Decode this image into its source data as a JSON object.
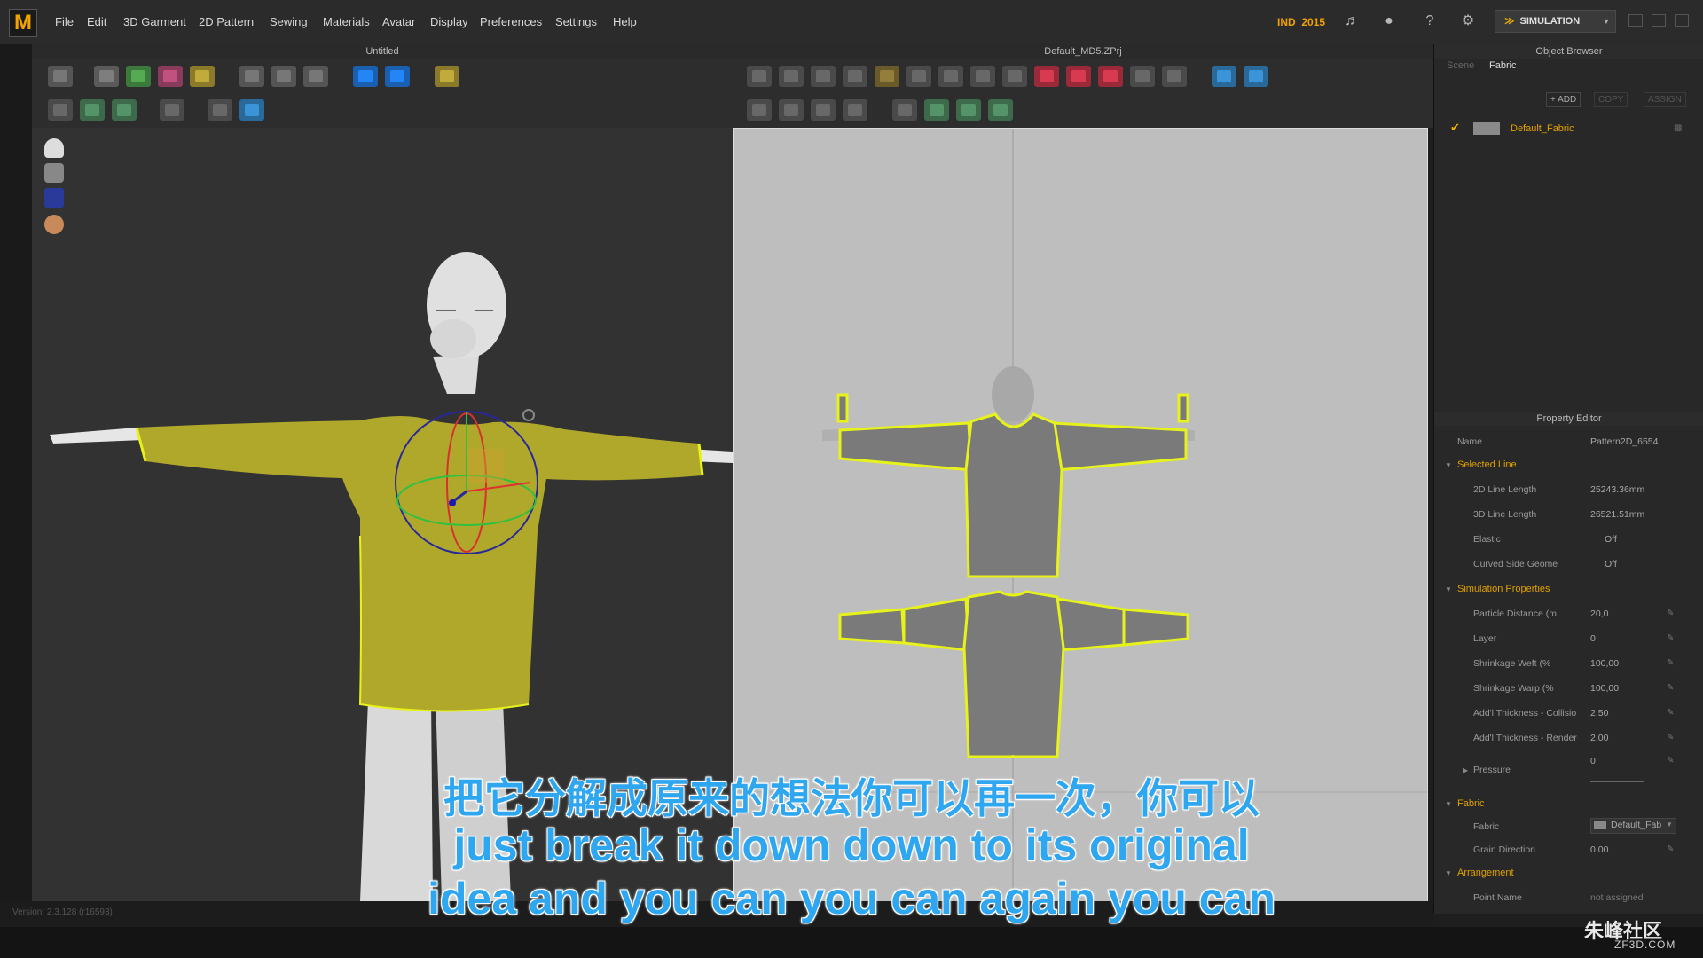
{
  "app": {
    "logo": "M"
  },
  "menu": [
    "File",
    "Edit",
    "3D Garment",
    "2D Pattern",
    "Sewing",
    "Materials",
    "Avatar",
    "Display",
    "Preferences",
    "Settings",
    "Help"
  ],
  "topbar": {
    "user": "IND_2015",
    "simulation_label": "SIMULATION"
  },
  "panel3d": {
    "title": "Untitled"
  },
  "panel2d": {
    "title": "Default_MD5.ZPrj"
  },
  "object_browser": {
    "title": "Object Browser",
    "tabs": [
      "Scene",
      "Fabric"
    ],
    "buttons": {
      "add": "+ ADD",
      "copy": "COPY",
      "assign": "ASSIGN"
    },
    "fabric_item": "Default_Fabric"
  },
  "property_editor": {
    "title": "Property Editor",
    "name_label": "Name",
    "name_value": "Pattern2D_6554",
    "selected_line": {
      "title": "Selected Line",
      "rows": [
        {
          "label": "2D Line Length",
          "value": "25243.36mm"
        },
        {
          "label": "3D Line Length",
          "value": "26521.51mm"
        },
        {
          "label": "Elastic",
          "value": "Off"
        },
        {
          "label": "Curved Side Geome",
          "value": "Off"
        }
      ]
    },
    "simulation_properties": {
      "title": "Simulation Properties",
      "rows": [
        {
          "label": "Particle Distance (m",
          "value": "20,0"
        },
        {
          "label": "Layer",
          "value": "0"
        },
        {
          "label": "Shrinkage Weft (%",
          "value": "100,00"
        },
        {
          "label": "Shrinkage Warp (%",
          "value": "100,00"
        },
        {
          "label": "Add'l Thickness - Collisio",
          "value": "2,50"
        },
        {
          "label": "Add'l Thickness - Render",
          "value": "2,00"
        }
      ],
      "pressure_label": "Pressure",
      "pressure_value": "0"
    },
    "fabric": {
      "title": "Fabric",
      "fabric_label": "Fabric",
      "fabric_value": "Default_Fab",
      "grain_label": "Grain Direction",
      "grain_value": "0,00"
    },
    "arrangement": {
      "title": "Arrangement",
      "point_label": "Point Name",
      "point_value": "not assigned"
    }
  },
  "status": {
    "version": "Version: 2.3.128    (r16593)"
  },
  "subtitles": {
    "cn": "把它分解成原来的想法你可以再一次，你可以",
    "en1": "just break it down down to its original",
    "en2": "idea and you can you can again you can"
  },
  "watermark": {
    "main": "朱峰社区",
    "sub": "ZF3D.COM"
  },
  "colors": {
    "accent": "#f0a000",
    "garment": "#b0a82a",
    "pattern_outline": "#e6f21a",
    "subtitle": "#2ea6f0"
  }
}
